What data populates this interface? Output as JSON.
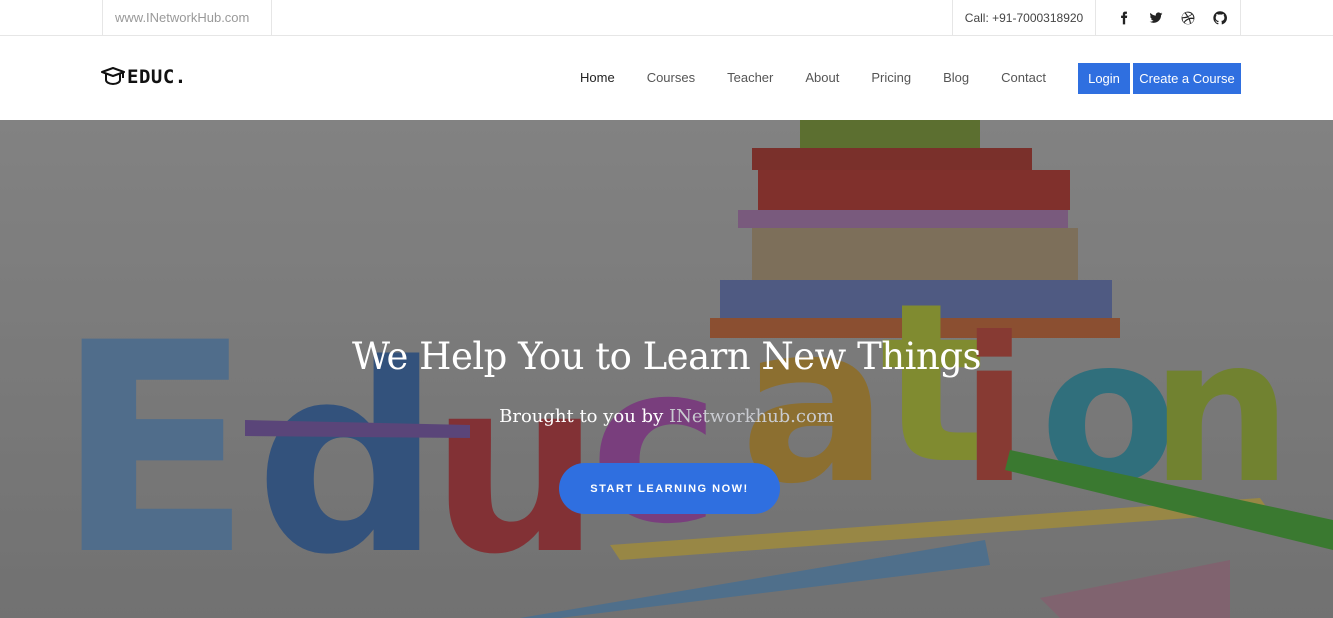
{
  "topbar": {
    "website": "www.INetworkHub.com",
    "phone": "Call: +91-7000318920",
    "social": [
      "facebook-icon",
      "twitter-icon",
      "dribbble-icon",
      "github-icon"
    ]
  },
  "nav": {
    "logo_text": "EDUC.",
    "items": [
      {
        "label": "Home"
      },
      {
        "label": "Courses"
      },
      {
        "label": "Teacher"
      },
      {
        "label": "About"
      },
      {
        "label": "Pricing"
      },
      {
        "label": "Blog"
      },
      {
        "label": "Contact"
      }
    ],
    "login_label": "Login",
    "create_label": "Create a Course",
    "accent_color": "#2f6fe0"
  },
  "hero": {
    "title": "We Help You to Learn New Things",
    "subtitle_prefix": "Brought to you by ",
    "subtitle_brand": "INetworkhub.com",
    "cta_label": "START LEARNING NOW!"
  }
}
